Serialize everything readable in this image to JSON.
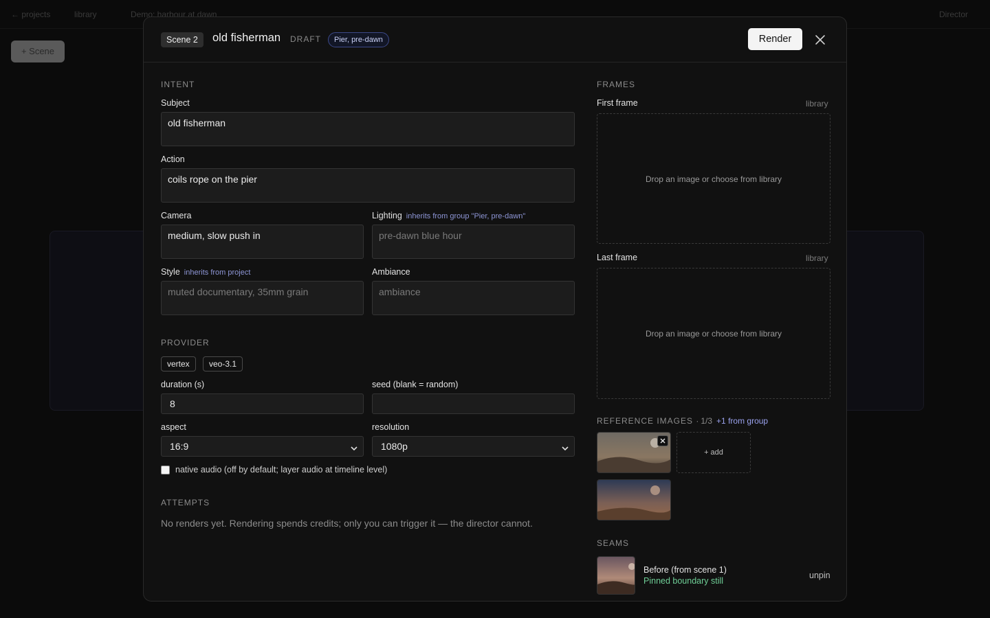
{
  "background": {
    "nav_back": "← projects",
    "nav_library": "library",
    "project_title": "Demo: harbour at dawn",
    "director_label": "Director",
    "scene_button": "+ Scene"
  },
  "modal": {
    "scene_chip": "Scene 2",
    "title": "old fisherman",
    "status": "DRAFT",
    "group_chip": "Pier, pre-dawn",
    "render_label": "Render",
    "close_icon": "close-icon"
  },
  "intent": {
    "section_title": "INTENT",
    "subject_label": "Subject",
    "subject_value": "old fisherman",
    "action_label": "Action",
    "action_value": "coils rope on the pier",
    "camera_label": "Camera",
    "camera_value": "medium, slow push in",
    "lighting_label": "Lighting",
    "lighting_inherit": "inherits from group \"Pier, pre-dawn\"",
    "lighting_placeholder": "pre-dawn blue hour",
    "style_label": "Style",
    "style_inherit": "inherits from project",
    "style_placeholder": "muted documentary, 35mm grain",
    "ambiance_label": "Ambiance",
    "ambiance_placeholder": "ambiance"
  },
  "provider": {
    "section_title": "PROVIDER",
    "provider_pill": "vertex",
    "model_pill": "veo-3.1",
    "duration_label": "duration (s)",
    "duration_value": "8",
    "seed_label": "seed (blank = random)",
    "seed_value": "",
    "aspect_label": "aspect",
    "aspect_value": "16:9",
    "resolution_label": "resolution",
    "resolution_value": "1080p",
    "audio_label": "native audio (off by default; layer audio at timeline level)",
    "audio_checked": false
  },
  "attempts": {
    "section_title": "ATTEMPTS",
    "empty_text": "No renders yet. Rendering spends credits; only you can trigger it — the director cannot."
  },
  "frames": {
    "section_title": "FRAMES",
    "first_label": "First frame",
    "first_library": "library",
    "first_drop": "Drop an image or choose from library",
    "last_label": "Last frame",
    "last_library": "library",
    "last_drop": "Drop an image or choose from library"
  },
  "references": {
    "title": "REFERENCE IMAGES ·",
    "count": "1/3",
    "from_group": "+1 from group",
    "add_label": "+ add"
  },
  "seams": {
    "section_title": "SEAMS",
    "before_label": "Before (from scene 1)",
    "before_status": "Pinned boundary still",
    "unpin_label": "unpin"
  },
  "colors": {
    "accent_inherit": "#8e96d6",
    "pinned_green": "#6fcf97",
    "group_chip_border": "#3d4a8a"
  }
}
